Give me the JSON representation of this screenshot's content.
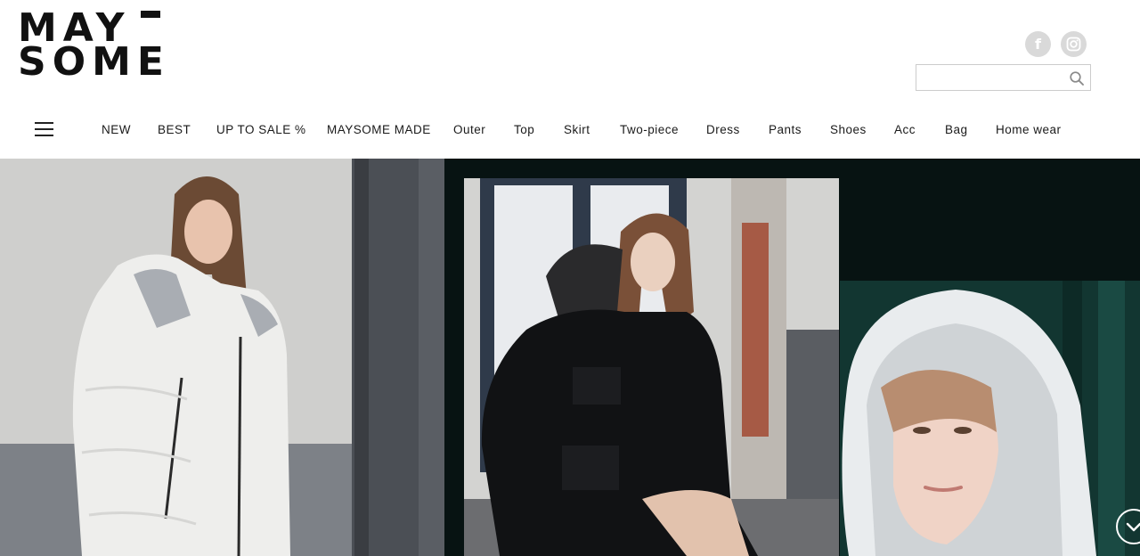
{
  "brand": {
    "logo_line1": "MAY",
    "logo_line2": "SOME"
  },
  "social": {
    "facebook_label": "f",
    "facebook_icon": "facebook-icon",
    "instagram_icon": "instagram-icon"
  },
  "search": {
    "value": "",
    "placeholder": "",
    "icon": "search-icon"
  },
  "nav": {
    "menu_icon": "hamburger-icon",
    "items": [
      {
        "label": "NEW"
      },
      {
        "label": "BEST"
      },
      {
        "label": "UP TO SALE %"
      },
      {
        "label": "MAYSOME MADE"
      },
      {
        "label": "Outer"
      },
      {
        "label": "Top"
      },
      {
        "label": "Skirt"
      },
      {
        "label": "Two-piece"
      },
      {
        "label": "Dress"
      },
      {
        "label": "Pants"
      },
      {
        "label": "Shoes"
      },
      {
        "label": "Acc"
      },
      {
        "label": "Bag"
      },
      {
        "label": "Home wear"
      }
    ]
  },
  "hero": {
    "background_color": "#071312",
    "scroll_icon": "chevron-down-icon"
  },
  "colors": {
    "text": "#1a1a1a",
    "social_bg": "#d9d9d9",
    "search_border": "#cccccc"
  }
}
